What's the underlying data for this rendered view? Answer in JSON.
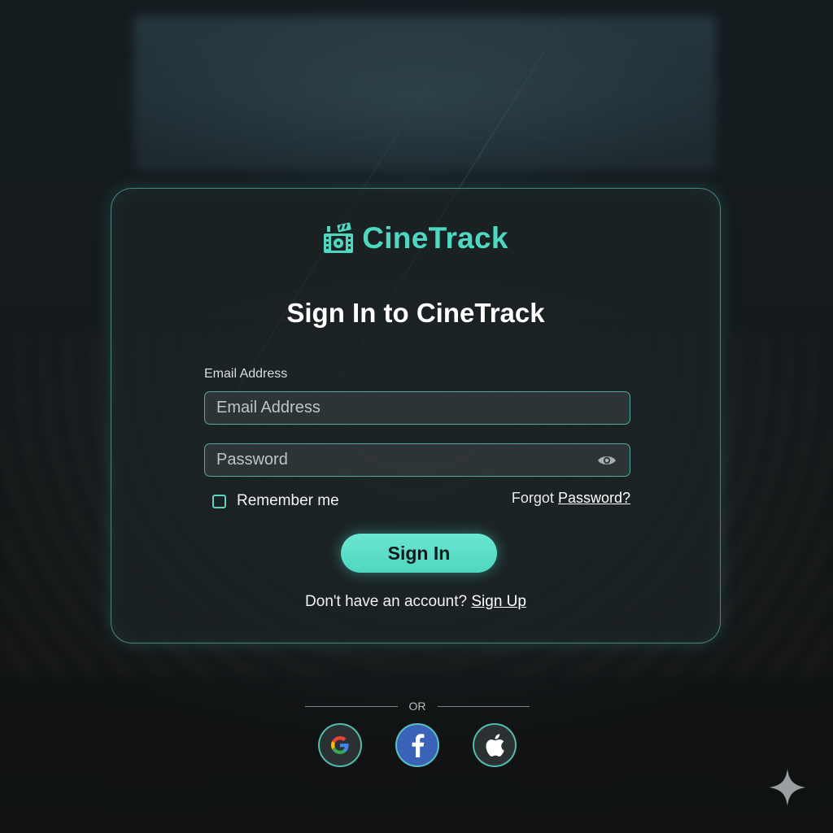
{
  "brand": {
    "name": "CineTrack",
    "icon": "clapperboard-icon",
    "accent_color": "#4fd8c1"
  },
  "form": {
    "title": "Sign In to CineTrack",
    "email_label": "Email Address",
    "email_placeholder": "Email Address",
    "password_placeholder": "Password",
    "password_toggle_icon": "eye-icon",
    "remember_label": "Remember me",
    "remember_checked": false,
    "forgot_prefix": "Forgot",
    "forgot_link": "Password?",
    "submit_label": "Sign In",
    "signup_prompt": "Don't have an account?",
    "signup_link": "Sign Up"
  },
  "social": {
    "divider_label": "OR",
    "providers": [
      {
        "icon": "google-icon"
      },
      {
        "icon": "facebook-icon"
      },
      {
        "icon": "apple-icon"
      }
    ]
  },
  "colors": {
    "button": "#5ddfca",
    "border": "#6edccd",
    "facebook": "#3a63b8"
  }
}
